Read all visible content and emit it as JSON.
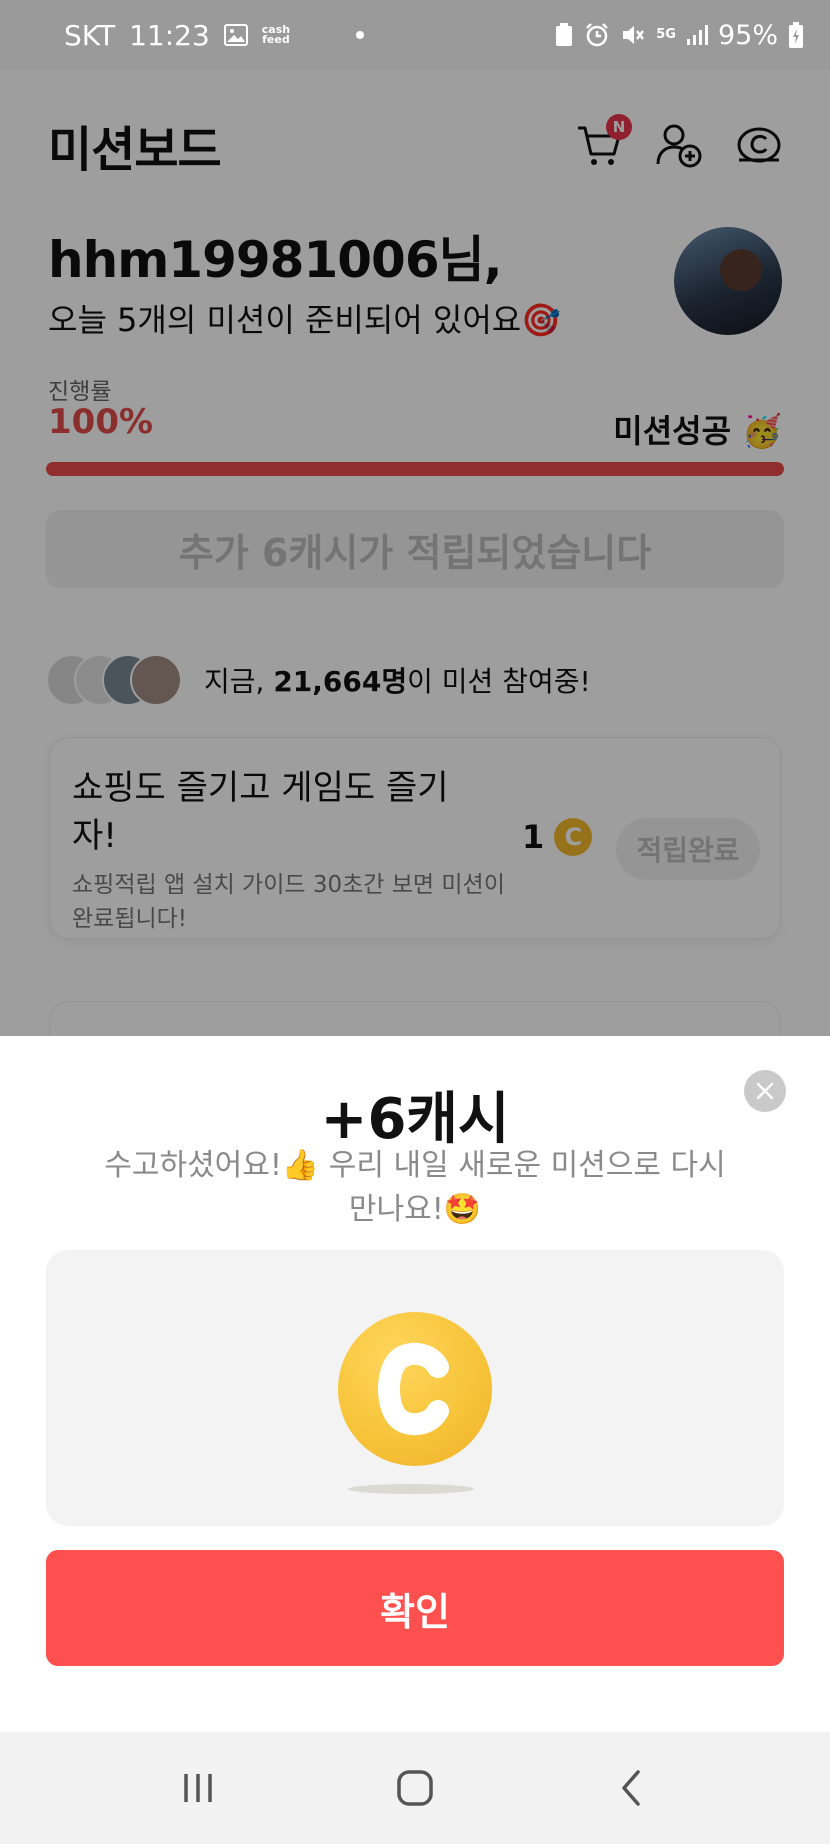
{
  "status_bar": {
    "carrier": "SKT",
    "time": "11:23",
    "cash_label": "cash\nfeed",
    "battery": "95%",
    "network": "5G"
  },
  "header": {
    "title": "미션보드",
    "cart_badge": "N",
    "icons": [
      "cart-icon",
      "add-friend-icon",
      "cash-icon"
    ]
  },
  "greeting": {
    "name": "hhm19981006님,",
    "subtitle": "오늘 5개의 미션이 준비되어 있어요🎯"
  },
  "progress": {
    "label": "진행률",
    "value_text": "100%",
    "value": 1.0,
    "status": "미션성공 🥳"
  },
  "reward_banner": "추가 6캐시가 적립되었습니다",
  "participants": {
    "prefix": "지금, ",
    "count": "21,664명",
    "suffix": "이 미션 참여중!"
  },
  "mission_card": {
    "title": "쇼핑도 즐기고 게임도 즐기자!",
    "description": "쇼핑적립 앱 설치 가이드 30초간 보면 미션이 완료됩니다!",
    "reward_amount": "1",
    "coin_symbol": "C",
    "button_label": "적립완료"
  },
  "sheet": {
    "title": "+6캐시",
    "message": "수고하셨어요!👍 우리 내일 새로운 미션으로 다시 만나요!🤩",
    "coin_symbol": "C",
    "confirm_label": "확인"
  },
  "colors": {
    "accent": "#ff5050",
    "progress": "#e84a4a",
    "coin": "#f7c43a",
    "badge": "#e8344a"
  }
}
